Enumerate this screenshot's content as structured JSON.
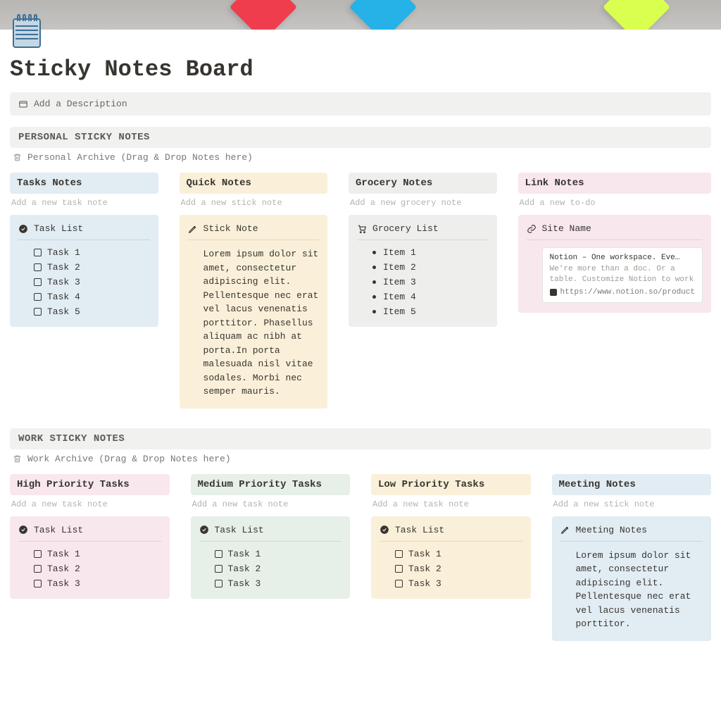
{
  "page": {
    "title": "Sticky Notes Board",
    "description_placeholder": "Add a Description"
  },
  "sections": {
    "personal": {
      "heading": "PERSONAL STICKY NOTES",
      "archive": "Personal Archive (Drag & Drop Notes here)",
      "columns": [
        {
          "title": "Tasks Notes",
          "placeholder": "Add a new task note"
        },
        {
          "title": "Quick Notes",
          "placeholder": "Add a new stick note"
        },
        {
          "title": "Grocery Notes",
          "placeholder": "Add a new grocery note"
        },
        {
          "title": "Link Notes",
          "placeholder": "Add a new to-do"
        }
      ]
    },
    "work": {
      "heading": "WORK STICKY NOTES",
      "archive": "Work Archive (Drag & Drop Notes here)",
      "columns": [
        {
          "title": "High Priority Tasks",
          "placeholder": "Add a new task note"
        },
        {
          "title": "Medium Priority Tasks",
          "placeholder": "Add a new task note"
        },
        {
          "title": "Low Priority Tasks",
          "placeholder": "Add a new task note"
        },
        {
          "title": "Meeting Notes",
          "placeholder": "Add a new stick note"
        }
      ]
    }
  },
  "cards": {
    "task_list": {
      "title": "Task List",
      "items": [
        "Task 1",
        "Task 2",
        "Task 3",
        "Task 4",
        "Task 5"
      ]
    },
    "task_list_short": {
      "title": "Task List",
      "items": [
        "Task 1",
        "Task 2",
        "Task 3"
      ]
    },
    "stick_note": {
      "title": "Stick Note",
      "body": "Lorem ipsum dolor sit amet, consectetur adipiscing elit. Pellentesque nec erat vel lacus venenatis porttitor. Phasellus aliquam ac nibh at porta.In porta malesuada nisl vitae sodales. Morbi nec semper mauris."
    },
    "grocery": {
      "title": "Grocery List",
      "items": [
        "Item 1",
        "Item 2",
        "Item 3",
        "Item 4",
        "Item 5"
      ]
    },
    "site": {
      "title": "Site Name",
      "link_title": "Notion – One workspace. Eve…",
      "link_desc": "We're more than a doc. Or a table. Customize Notion to work",
      "link_url": "https://www.notion.so/product"
    },
    "meeting": {
      "title": "Meeting Notes",
      "body": "Lorem ipsum dolor sit amet, consectetur adipiscing elit. Pellentesque nec erat vel lacus venenatis porttitor."
    }
  }
}
